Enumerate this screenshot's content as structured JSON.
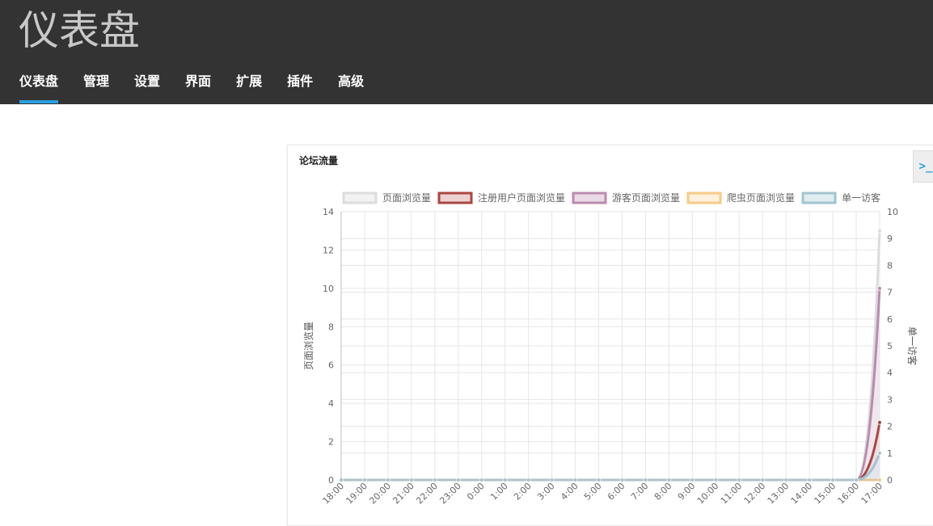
{
  "header": {
    "title": "仪表盘"
  },
  "nav": [
    {
      "label": "仪表盘",
      "active": true
    },
    {
      "label": "管理",
      "active": false
    },
    {
      "label": "设置",
      "active": false
    },
    {
      "label": "界面",
      "active": false
    },
    {
      "label": "扩展",
      "active": false
    },
    {
      "label": "插件",
      "active": false
    },
    {
      "label": "高级",
      "active": false
    }
  ],
  "panel": {
    "title": "论坛流量"
  },
  "terminal": {
    "label": ">_"
  },
  "chart_data": {
    "type": "line",
    "x": [
      "18:00",
      "19:00",
      "20:00",
      "21:00",
      "22:00",
      "23:00",
      "0:00",
      "1:00",
      "2:00",
      "3:00",
      "4:00",
      "5:00",
      "6:00",
      "7:00",
      "8:00",
      "9:00",
      "10:00",
      "11:00",
      "12:00",
      "13:00",
      "14:00",
      "15:00",
      "16:00",
      "17:00"
    ],
    "ylabel": "页面浏览量",
    "y2label": "单一访客",
    "ylim": [
      0,
      14
    ],
    "y2lim": [
      0,
      10
    ],
    "yticks": [
      0,
      2,
      4,
      6,
      8,
      10,
      12,
      14
    ],
    "y2ticks": [
      0,
      1,
      2,
      3,
      4,
      5,
      6,
      7,
      8,
      9,
      10
    ],
    "grid": true,
    "legend_position": "top",
    "series": [
      {
        "name": "页面浏览量",
        "axis": "left",
        "color": "#dcdcdc",
        "fill": "#f2f2f2",
        "values": [
          0,
          0,
          0,
          0,
          0,
          0,
          0,
          0,
          0,
          0,
          0,
          0,
          0,
          0,
          0,
          0,
          0,
          0,
          0,
          0,
          0,
          0,
          0,
          13
        ]
      },
      {
        "name": "注册用户页面浏览量",
        "axis": "left",
        "color": "#ab4642",
        "fill": "#ecd2d1",
        "values": [
          0,
          0,
          0,
          0,
          0,
          0,
          0,
          0,
          0,
          0,
          0,
          0,
          0,
          0,
          0,
          0,
          0,
          0,
          0,
          0,
          0,
          0,
          0,
          3
        ]
      },
      {
        "name": "游客页面浏览量",
        "axis": "left",
        "color": "#ba8baf",
        "fill": "#ead9e6",
        "values": [
          0,
          0,
          0,
          0,
          0,
          0,
          0,
          0,
          0,
          0,
          0,
          0,
          0,
          0,
          0,
          0,
          0,
          0,
          0,
          0,
          0,
          0,
          0,
          10
        ]
      },
      {
        "name": "爬虫页面浏览量",
        "axis": "left",
        "color": "#f7ca88",
        "fill": "#fdf0dc",
        "values": [
          0,
          0,
          0,
          0,
          0,
          0,
          0,
          0,
          0,
          0,
          0,
          0,
          0,
          0,
          0,
          0,
          0,
          0,
          0,
          0,
          0,
          0,
          0,
          0
        ]
      },
      {
        "name": "单一访客",
        "axis": "right",
        "color": "#a1c4d0",
        "fill": "#dfecf0",
        "values": [
          0,
          0,
          0,
          0,
          0,
          0,
          0,
          0,
          0,
          0,
          0,
          0,
          0,
          0,
          0,
          0,
          0,
          0,
          0,
          0,
          0,
          0,
          0,
          1
        ]
      }
    ]
  }
}
